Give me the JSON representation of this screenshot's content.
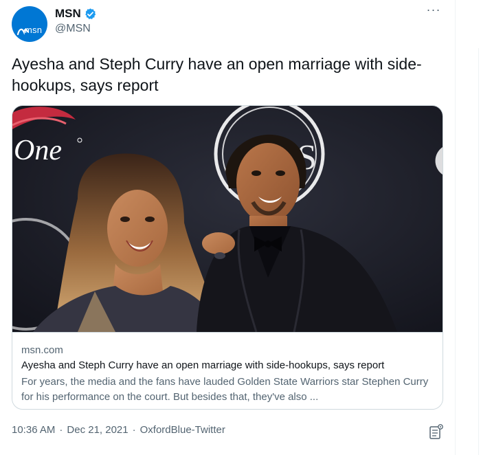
{
  "author": {
    "display_name": "MSN",
    "handle": "@MSN",
    "avatar_logo": "msn",
    "verified": true
  },
  "tweet": {
    "text": "Ayesha and Steph Curry have an open marriage with side-hookups, says report"
  },
  "card": {
    "domain": "msn.com",
    "title": "Ayesha and Steph Curry have an open marriage with side-hookups, says report",
    "description": "For years, the media and the fans have lauded Golden State Warriors star Stephen Curry for his performance on the court. But besides that, they've also ...",
    "image_backdrop_text": "One"
  },
  "meta": {
    "time": "10:36 AM",
    "separator": "·",
    "date": "Dec 21, 2021",
    "source": "OxfordBlue-Twitter"
  },
  "colors": {
    "accent": "#1d9bf0",
    "msn_blue": "#0077d4",
    "text_primary": "#0f1419",
    "text_secondary": "#536471",
    "border": "#cfd9de"
  },
  "icons": {
    "verified": "verified-badge-icon",
    "more": "more-icon",
    "analytics": "analytics-icon"
  }
}
